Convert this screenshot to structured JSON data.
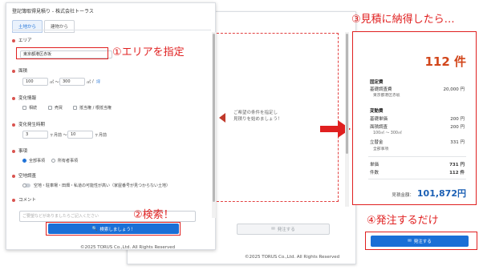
{
  "front": {
    "title": "登記簿取得見積り - 株式会社トーラス",
    "tabs": [
      "土地から",
      "建物から"
    ],
    "area": {
      "label": "エリア",
      "value": "東京都港区赤坂"
    },
    "size": {
      "label": "面積",
      "min": "100",
      "min_unit": "㎡ ～",
      "max": "300",
      "max_unit": "㎡",
      "extra": "/",
      "extra2": "坪"
    },
    "change_info": {
      "label": "変化情報",
      "options": [
        "相続",
        "売買",
        "抵当権 / 根抵当権"
      ]
    },
    "change_period": {
      "label": "変化発生時期",
      "from": "3",
      "from_unit": "ヶ月前 ～",
      "to": "10",
      "to_unit": "ヶ月前"
    },
    "matter": {
      "label": "事項",
      "options": [
        "全部事項",
        "所有者事項"
      ]
    },
    "vacancy": {
      "label": "空地調査",
      "toggle_text": "空地・駐車場・田畑・私道の可能性が高い（家屋番号が見つからない土地）"
    },
    "comment": {
      "label": "コメント",
      "placeholder": "ご要望などがありましたらご記入ください"
    },
    "search_button": "検索しましょう！",
    "footer": "©2025 TORUS Co.,Ltd. All Rights Reserved"
  },
  "back": {
    "hint_lines": [
      "ご希望の条件を指定し",
      "見積りを始めましょう！"
    ],
    "order_button": "発注する",
    "footer": "©2025 TORUS Co.,Ltd. All Rights Reserved"
  },
  "estimate": {
    "count": "112 件",
    "fixed_header": "固定費",
    "basic_survey_label": "基礎調査費",
    "basic_survey_value": "20,000 円",
    "basic_survey_sub": "東京都港区赤坂",
    "variable_header": "変動費",
    "basic_unit_label": "基礎単価",
    "basic_unit_value": "200 円",
    "area_survey_label": "面積調査",
    "area_survey_value": "200 円",
    "area_survey_sub": "100㎡ ～ 300㎡",
    "advance_label": "立替金",
    "advance_value": "331 円",
    "advance_sub": "全部事項",
    "unit_price_label": "単価",
    "unit_price_value": "731 円",
    "count_label": "件数",
    "count_value": "112 件",
    "total_label": "見積金額：",
    "total_value": "101,872円",
    "order_button": "発注する"
  },
  "annotations": {
    "step1": "①エリアを指定",
    "step2": "②検索！",
    "step3": "③見積に納得したら…",
    "step4": "④発注するだけ"
  }
}
